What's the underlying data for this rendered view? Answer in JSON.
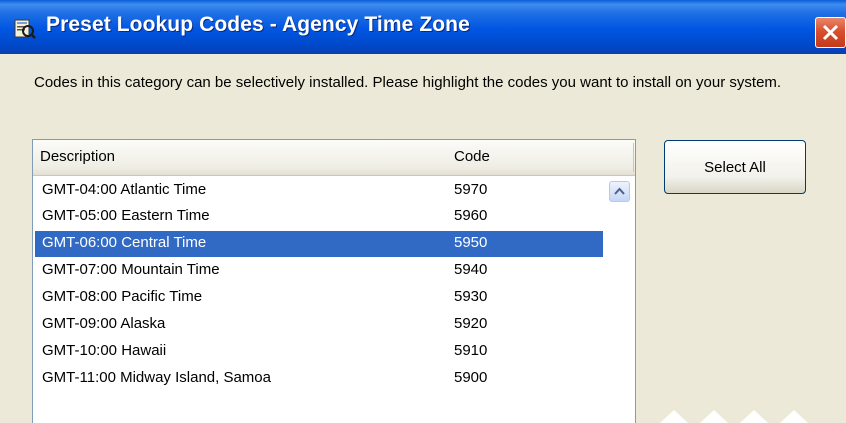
{
  "window": {
    "title": "Preset Lookup Codes - Agency Time Zone",
    "title_icon": "lookup-book-icon",
    "close_icon": "close-icon"
  },
  "instructions": "Codes in this category can be selectively installed. Please highlight the codes you want to install on your system.",
  "list": {
    "columns": {
      "description": "Description",
      "code": "Code"
    },
    "rows": [
      {
        "description": "GMT-04:00 Atlantic Time",
        "code": "5970",
        "selected": false
      },
      {
        "description": "GMT-05:00 Eastern Time",
        "code": "5960",
        "selected": false
      },
      {
        "description": "GMT-06:00 Central Time",
        "code": "5950",
        "selected": true
      },
      {
        "description": "GMT-07:00 Mountain Time",
        "code": "5940",
        "selected": false
      },
      {
        "description": "GMT-08:00 Pacific Time",
        "code": "5930",
        "selected": false
      },
      {
        "description": "GMT-09:00 Alaska",
        "code": "5920",
        "selected": false
      },
      {
        "description": "GMT-10:00 Hawaii",
        "code": "5910",
        "selected": false
      },
      {
        "description": "GMT-11:00 Midway Island, Samoa",
        "code": "5900",
        "selected": false
      }
    ],
    "scroll_icon": "scroll-up-arrow-icon"
  },
  "buttons": {
    "select_all": "Select All"
  },
  "colors": {
    "title_bar": "#0055e2",
    "selection": "#316ac5",
    "dialog_face": "#ece9d8",
    "close_button": "#d8502f"
  }
}
